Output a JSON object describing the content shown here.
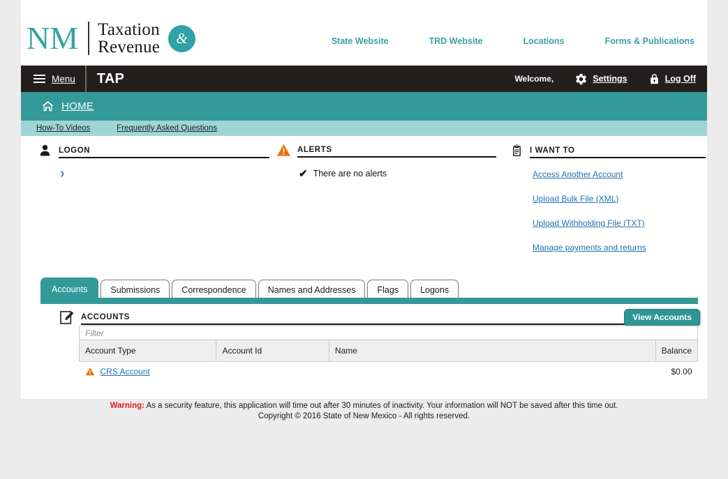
{
  "brand": {
    "nm": "NM",
    "line1": "Taxation",
    "line2": "Revenue",
    "ampersand": "&"
  },
  "topnav": [
    {
      "label": "State Website"
    },
    {
      "label": "TRD Website"
    },
    {
      "label": "Locations"
    },
    {
      "label": "Forms & Publications"
    }
  ],
  "menubar": {
    "menu_label": "Menu",
    "app_title": "TAP",
    "welcome": "Welcome,",
    "settings_label": "Settings",
    "logoff_label": "Log Off"
  },
  "homebar": {
    "label": "HOME"
  },
  "subbar": [
    {
      "label": "How-To Videos"
    },
    {
      "label": "Frequently Asked Questions"
    }
  ],
  "panels": {
    "logon": {
      "title": "LOGON",
      "expander": "›"
    },
    "alerts": {
      "title": "ALERTS",
      "message": "There are no alerts",
      "check": "✔"
    },
    "iwantto": {
      "title": "I WANT TO",
      "links": [
        {
          "label": "Access Another Account"
        },
        {
          "label": "Upload Bulk File (XML)"
        },
        {
          "label": "Upload Withholding File (TXT)"
        },
        {
          "label": "Manage payments and returns"
        }
      ]
    }
  },
  "tabs": [
    {
      "label": "Accounts",
      "active": true
    },
    {
      "label": "Submissions",
      "active": false
    },
    {
      "label": "Correspondence",
      "active": false
    },
    {
      "label": "Names and Addresses",
      "active": false
    },
    {
      "label": "Flags",
      "active": false
    },
    {
      "label": "Logons",
      "active": false
    }
  ],
  "accounts": {
    "title": "ACCOUNTS",
    "view_button": "View Accounts",
    "filter_placeholder": "Filter",
    "columns": [
      "Account Type",
      "Account Id",
      "Name",
      "Balance"
    ],
    "rows": [
      {
        "account_type": "CRS Account",
        "account_id": "",
        "name": "",
        "balance": "$0.00"
      }
    ]
  },
  "footer": {
    "warning_label": "Warning:",
    "warning_text": " As a security feature, this application will time out after 30 minutes of inactivity. Your information will NOT be saved after this time out.",
    "copyright": "Copyright © 2016 State of New Mexico - All rights reserved."
  },
  "colors": {
    "teal": "#349999",
    "teal_light": "#9fd5d5",
    "dark": "#231f1f",
    "link_blue": "#1d72b8",
    "alert_orange": "#ef6c00",
    "warning_red": "#e01b1b"
  }
}
